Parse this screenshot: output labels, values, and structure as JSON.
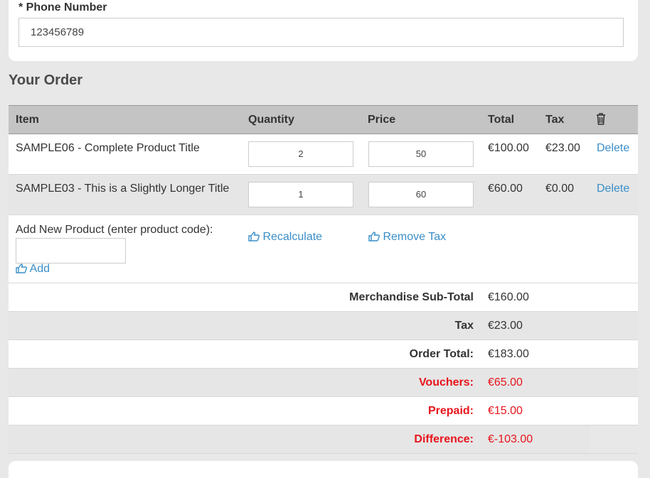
{
  "phone": {
    "label": "* Phone Number",
    "value": "123456789"
  },
  "order": {
    "title": "Your Order",
    "headers": {
      "item": "Item",
      "quantity": "Quantity",
      "price": "Price",
      "total": "Total",
      "tax": "Tax",
      "delete_icon": "trash-icon"
    },
    "rows": [
      {
        "item": "SAMPLE06 - Complete Product Title",
        "quantity": "2",
        "price": "50",
        "total": "€100.00",
        "tax": "€23.00",
        "delete": "Delete"
      },
      {
        "item": "SAMPLE03 - This is a Slightly Longer Title",
        "quantity": "1",
        "price": "60",
        "total": "€60.00",
        "tax": "€0.00",
        "delete": "Delete"
      }
    ],
    "add_product": {
      "label": "Add New Product (enter product code):",
      "code_value": "",
      "add_link": "Add",
      "recalculate_link": "Recalculate",
      "remove_tax_link": "Remove Tax",
      "icon": "hand-pointing-icon"
    },
    "summary": [
      {
        "label": "Merchandise Sub-Total",
        "value": "€160.00"
      },
      {
        "label": "Tax",
        "value": "€23.00"
      },
      {
        "label": "Order Total:",
        "value": "€183.00"
      },
      {
        "label": "Vouchers:",
        "value": "€65.00"
      },
      {
        "label": "Prepaid:",
        "value": "€15.00"
      },
      {
        "label": "Difference:",
        "value": "€-103.00"
      }
    ]
  },
  "colors": {
    "link": "#3a8ec8",
    "negative": "#e8141b",
    "header_bg": "#c4c4c4",
    "page_bg": "#e8e8e8"
  }
}
